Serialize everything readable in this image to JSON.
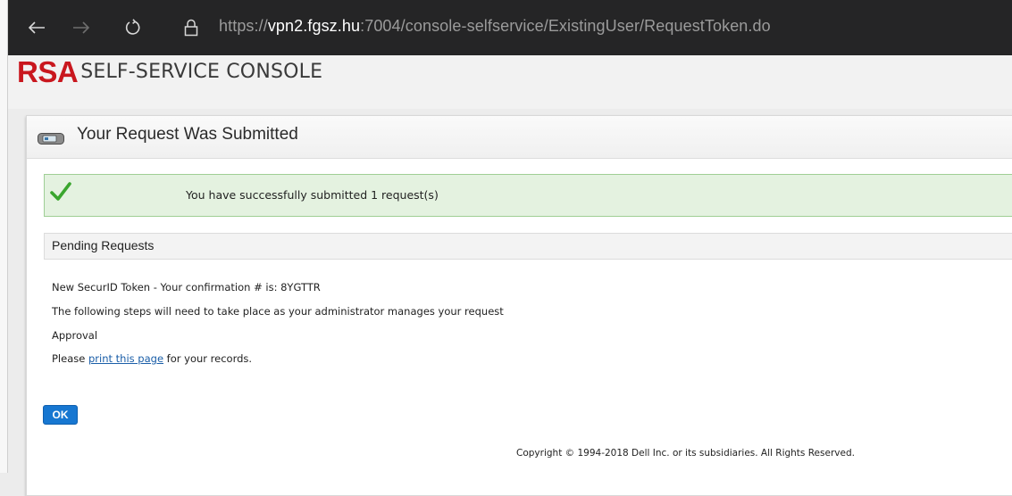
{
  "browser": {
    "url_scheme": "https://",
    "url_host": "vpn2.fgsz.hu",
    "url_rest": ":7004/console-selfservice/ExistingUser/RequestToken.do",
    "icons": [
      "back-arrow-icon",
      "forward-arrow-icon",
      "refresh-icon",
      "lock-icon"
    ]
  },
  "header": {
    "logo_rsa": "RSA",
    "logo_text": "SELF-SERVICE CONSOLE"
  },
  "panel": {
    "title": "Your Request Was Submitted",
    "title_icon": "token-icon",
    "success_message": "You have successfully submitted 1 request(s)",
    "success_icon": "checkmark-icon",
    "pending_title": "Pending Requests",
    "lines": {
      "token_line": "New SecurID Token - Your confirmation # is: 8YGTTR",
      "steps_line": "The following steps will need to take place as your administrator manages your request",
      "approval_line": "Approval",
      "print_prefix": "Please ",
      "print_link": "print this page",
      "print_suffix": " for your records."
    },
    "ok_label": "OK"
  },
  "footer": {
    "copyright": "Copyright © 1994-2018 Dell Inc. or its subsidiaries. All Rights Reserved."
  },
  "colors": {
    "browser_bar": "#252526",
    "rsa_red": "#c9171e",
    "link_blue": "#1a5ea8",
    "button_blue": "#1777d1",
    "success_bg": "#e4f2e0",
    "success_border": "#9fcf95",
    "check_green": "#3aa62e"
  }
}
